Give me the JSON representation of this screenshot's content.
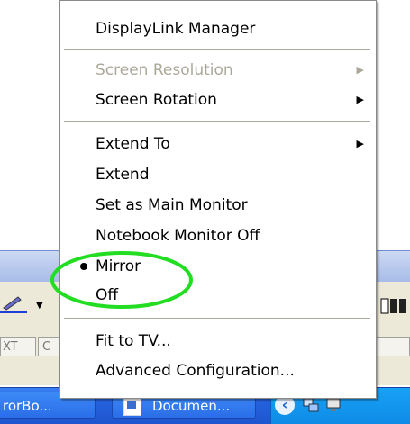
{
  "menu": {
    "title": "DisplayLink Manager",
    "items": [
      {
        "label": "Screen Resolution",
        "disabled": true,
        "submenu": true
      },
      {
        "label": "Screen Rotation",
        "disabled": false,
        "submenu": true
      },
      {
        "label": "Extend To",
        "disabled": false,
        "submenu": true
      },
      {
        "label": "Extend",
        "disabled": false
      },
      {
        "label": "Set as Main Monitor",
        "disabled": false
      },
      {
        "label": "Notebook Monitor Off",
        "disabled": false
      },
      {
        "label": "Mirror",
        "disabled": false,
        "selected": true
      },
      {
        "label": "Off",
        "disabled": false
      },
      {
        "label": "Fit to TV...",
        "disabled": false
      },
      {
        "label": "Advanced Configuration...",
        "disabled": false
      }
    ]
  },
  "background": {
    "field_text_1": "XT",
    "field_text_2": "C"
  },
  "taskbar": {
    "button_1": "rorBo...",
    "button_2": "Documen..."
  },
  "colors": {
    "highlight_circle": "#22dd22",
    "taskbar_blue": "#245edb",
    "tray_blue": "#0f8be6",
    "disabled_text": "#aca899"
  }
}
